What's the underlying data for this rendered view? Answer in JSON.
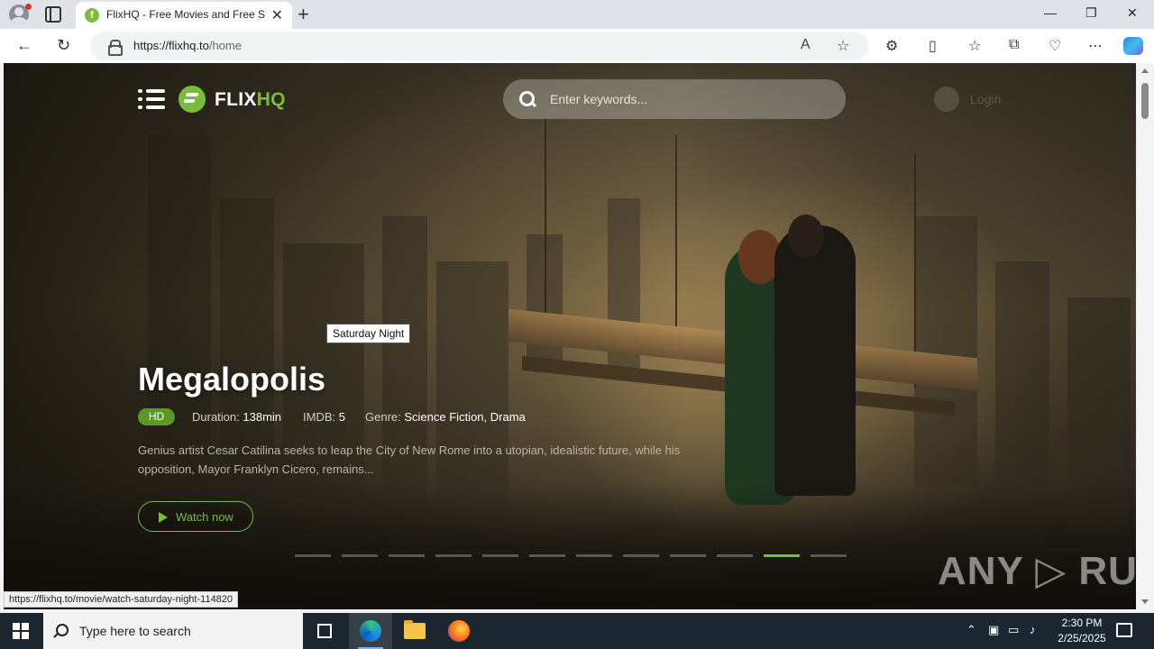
{
  "browser": {
    "tab_title": "FlixHQ - Free Movies and Free Series",
    "url_host": "https://flixhq.to",
    "url_path": "/home",
    "status_link": "https://flixhq.to/movie/watch-saturday-night-114820"
  },
  "site": {
    "logo_text": "FLIX",
    "logo_accent": "HQ",
    "search_placeholder": "Enter keywords...",
    "login_label": "Login"
  },
  "hero": {
    "title": "Megalopolis",
    "quality": "HD",
    "duration_label": "Duration:",
    "duration_value": "138min",
    "imdb_label": "IMDB:",
    "imdb_value": "5",
    "genre_label": "Genre:",
    "genre_value": "Science Fiction, Drama",
    "description": "Genius artist Cesar Catilina seeks to leap the City of New Rome into a utopian, idealistic future, while his opposition, Mayor Franklyn Cicero, remains...",
    "watch_label": "Watch now",
    "tooltip": "Saturday Night",
    "slide_count": 12,
    "active_slide": 11
  },
  "watermark": "ANY ▷ RUN",
  "taskbar": {
    "search_placeholder": "Type here to search",
    "time": "2:30 PM",
    "date": "2/25/2025"
  },
  "colors": {
    "accent": "#7dbb3b",
    "taskbar": "#1c2630"
  }
}
